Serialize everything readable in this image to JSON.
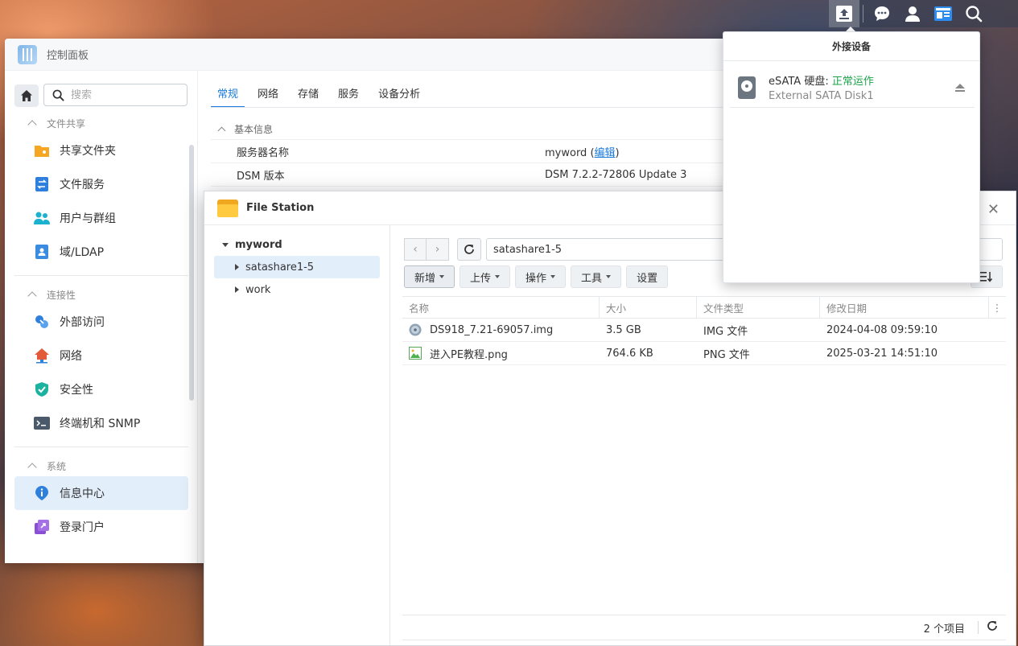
{
  "taskbar": {
    "icons": [
      "upload-icon",
      "chat-icon",
      "user-icon",
      "widgets-icon",
      "search-icon"
    ]
  },
  "control_panel": {
    "title": "控制面板",
    "search_placeholder": "搜索",
    "groups": [
      {
        "label": "文件共享",
        "items": [
          {
            "label": "共享文件夹",
            "icon": "shared-folder-icon",
            "color": "#f5a623"
          },
          {
            "label": "文件服务",
            "icon": "file-services-icon",
            "color": "#2f7fdc"
          },
          {
            "label": "用户与群组",
            "icon": "users-groups-icon",
            "color": "#1bb2d0"
          },
          {
            "label": "域/LDAP",
            "icon": "domain-ldap-icon",
            "color": "#3b8be0"
          }
        ]
      },
      {
        "label": "连接性",
        "items": [
          {
            "label": "外部访问",
            "icon": "external-access-icon",
            "color": "#2f7fdc"
          },
          {
            "label": "网络",
            "icon": "network-icon",
            "color": "#e25a3a"
          },
          {
            "label": "安全性",
            "icon": "security-icon",
            "color": "#1bb2a0"
          },
          {
            "label": "终端机和 SNMP",
            "icon": "terminal-icon",
            "color": "#4a5a6a"
          }
        ]
      },
      {
        "label": "系统",
        "items": [
          {
            "label": "信息中心",
            "icon": "info-center-icon",
            "color": "#2f7fdc"
          },
          {
            "label": "登录门户",
            "icon": "login-portal-icon",
            "color": "#8a4fd6"
          }
        ]
      }
    ],
    "tabs": [
      "常规",
      "网络",
      "存储",
      "服务",
      "设备分析"
    ],
    "active_tab": "常规",
    "section_title": "基本信息",
    "rows": [
      {
        "key": "服务器名称",
        "value": "myword",
        "link_open": " (",
        "link": "编辑",
        "link_close": ")"
      },
      {
        "key": "DSM 版本",
        "value": "DSM 7.2.2-72806 Update 3"
      }
    ]
  },
  "file_station": {
    "title": "File Station",
    "tree": {
      "root": "myword",
      "children": [
        "satashare1-5",
        "work"
      ],
      "selected": "satashare1-5"
    },
    "path": "satashare1-5",
    "toolbar": {
      "create": "新增",
      "upload": "上传",
      "action": "操作",
      "tools": "工具",
      "settings": "设置"
    },
    "columns": {
      "name": "名称",
      "size": "大小",
      "type": "文件类型",
      "modified": "修改日期"
    },
    "files": [
      {
        "name": "DS918_7.21-69057.img",
        "size": "3.5 GB",
        "type": "IMG 文件",
        "modified": "2024-04-08 09:59:10",
        "icon": "disk-image-icon"
      },
      {
        "name": "进入PE教程.png",
        "size": "764.6 KB",
        "type": "PNG 文件",
        "modified": "2025-03-21 14:51:10",
        "icon": "image-file-icon"
      }
    ],
    "footer_count": "2 个项目"
  },
  "external_devices": {
    "title": "外接设备",
    "device": {
      "name_prefix": "eSATA 硬盘: ",
      "status": "正常运作",
      "description": "External SATA Disk1",
      "status_color": "#1aa34a"
    }
  }
}
